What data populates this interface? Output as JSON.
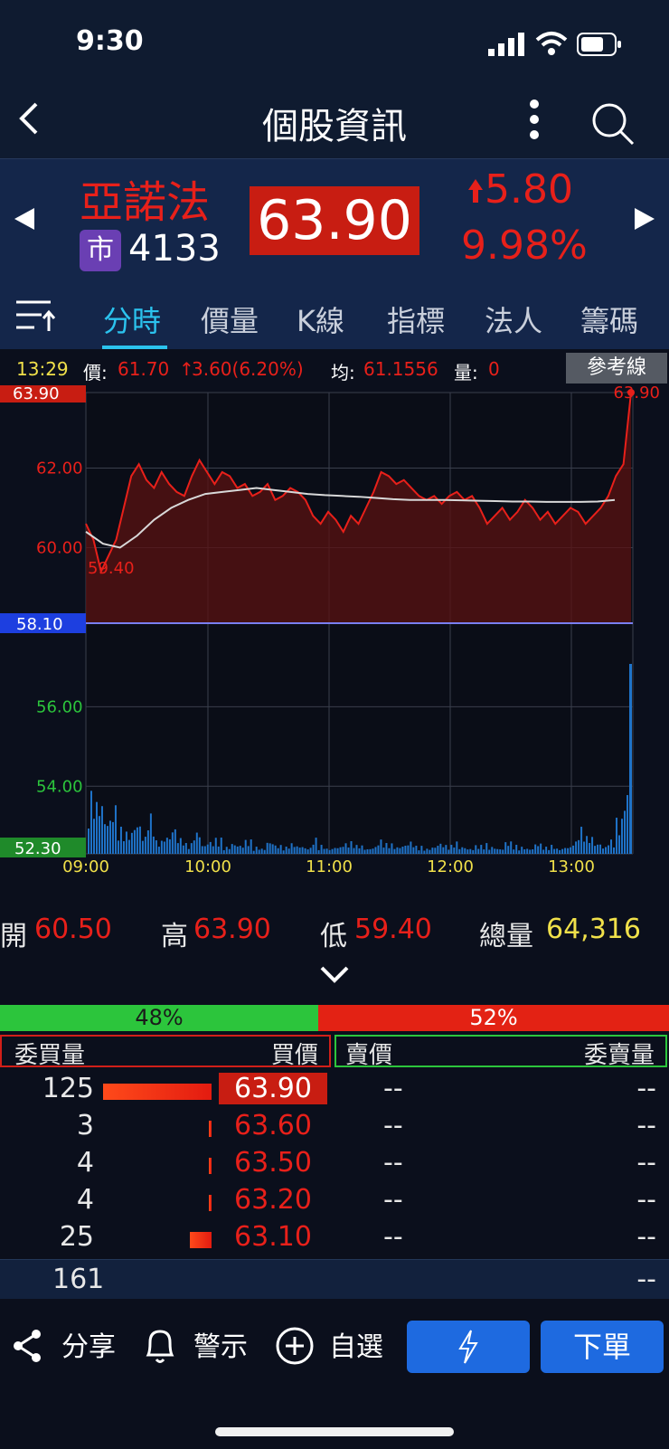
{
  "status_bar": {
    "time": "9:30"
  },
  "nav": {
    "title": "個股資訊"
  },
  "quote": {
    "name": "亞諾法",
    "market_badge": "市",
    "code": "4133",
    "price": "63.90",
    "change": "5.80",
    "change_pct": "9.98%",
    "color_up": "#e8201a"
  },
  "tabs": [
    "分時",
    "價量",
    "K線",
    "指標",
    "法人",
    "籌碼"
  ],
  "active_tab": "分時",
  "info_line": {
    "time": "13:29",
    "price_label": "價:",
    "price": "61.70",
    "change": "3.60(6.20%)",
    "avg_label": "均:",
    "avg": "61.1556",
    "vol_label": "量:",
    "vol": "0",
    "ref_button": "參考線"
  },
  "chart_data": {
    "type": "line",
    "x_ticks": [
      "09:00",
      "10:00",
      "11:00",
      "12:00",
      "13:00"
    ],
    "y_ticks": [
      "63.90",
      "62.00",
      "60.00",
      "58.10",
      "56.00",
      "54.00",
      "52.30"
    ],
    "reference_price": 58.1,
    "ylim": [
      52.3,
      63.9
    ],
    "annotations": {
      "low": "59.40",
      "last": "63.90"
    },
    "series": [
      {
        "values": [
          60.6,
          60.2,
          59.4,
          59.8,
          60.2,
          61.0,
          61.8,
          62.1,
          61.7,
          61.5,
          61.9,
          61.6,
          61.4,
          61.3,
          61.8,
          62.2,
          61.9,
          61.6,
          61.9,
          61.8,
          61.5,
          61.6,
          61.3,
          61.4,
          61.6,
          61.2,
          61.3,
          61.5,
          61.4,
          61.2,
          60.8,
          60.6,
          60.9,
          60.7,
          60.4,
          60.8,
          60.6,
          61.0,
          61.4,
          61.9,
          61.8,
          61.6,
          61.7,
          61.5,
          61.3,
          61.2,
          61.3,
          61.1,
          61.3,
          61.4,
          61.2,
          61.3,
          61.0,
          60.6,
          60.8,
          61.0,
          60.7,
          60.9,
          61.2,
          61.0,
          60.7,
          60.9,
          60.6,
          60.8,
          61.0,
          60.9,
          60.6,
          60.8,
          61.0,
          61.3,
          61.8,
          62.1,
          63.9
        ]
      },
      {
        "values": [
          60.4,
          60.1,
          60.0,
          60.3,
          60.7,
          61.0,
          61.2,
          61.35,
          61.4,
          61.45,
          61.5,
          61.45,
          61.4,
          61.35,
          61.32,
          61.3,
          61.28,
          61.25,
          61.22,
          61.2,
          61.2,
          61.2,
          61.19,
          61.18,
          61.17,
          61.16,
          61.16,
          61.15,
          61.15,
          61.15,
          61.16,
          61.2
        ]
      }
    ],
    "volume_note": "histogram bars under price"
  },
  "stats": {
    "open_label": "開",
    "open": "60.50",
    "high_label": "高",
    "high": "63.90",
    "low_label": "低",
    "low": "59.40",
    "vol_label": "總量",
    "vol": "64,316"
  },
  "order_book": {
    "buy_pct": "48%",
    "sell_pct": "52%",
    "headers": {
      "buy_vol": "委買量",
      "buy_price": "買價",
      "sell_price": "賣價",
      "sell_vol": "委賣量"
    },
    "rows": [
      {
        "bv": "125",
        "bp": "63.90",
        "sp": "--",
        "sv": "--",
        "bar": 0.9
      },
      {
        "bv": "3",
        "bp": "63.60",
        "sp": "--",
        "sv": "--",
        "bar": 0.02
      },
      {
        "bv": "4",
        "bp": "63.50",
        "sp": "--",
        "sv": "--",
        "bar": 0.02
      },
      {
        "bv": "4",
        "bp": "63.20",
        "sp": "--",
        "sv": "--",
        "bar": 0.02
      },
      {
        "bv": "25",
        "bp": "63.10",
        "sp": "--",
        "sv": "--",
        "bar": 0.18
      }
    ],
    "total_buy": "161",
    "total_sell": "--"
  },
  "bottom_bar": {
    "share": "分享",
    "alert": "警示",
    "watch": "自選",
    "order": "下單"
  }
}
